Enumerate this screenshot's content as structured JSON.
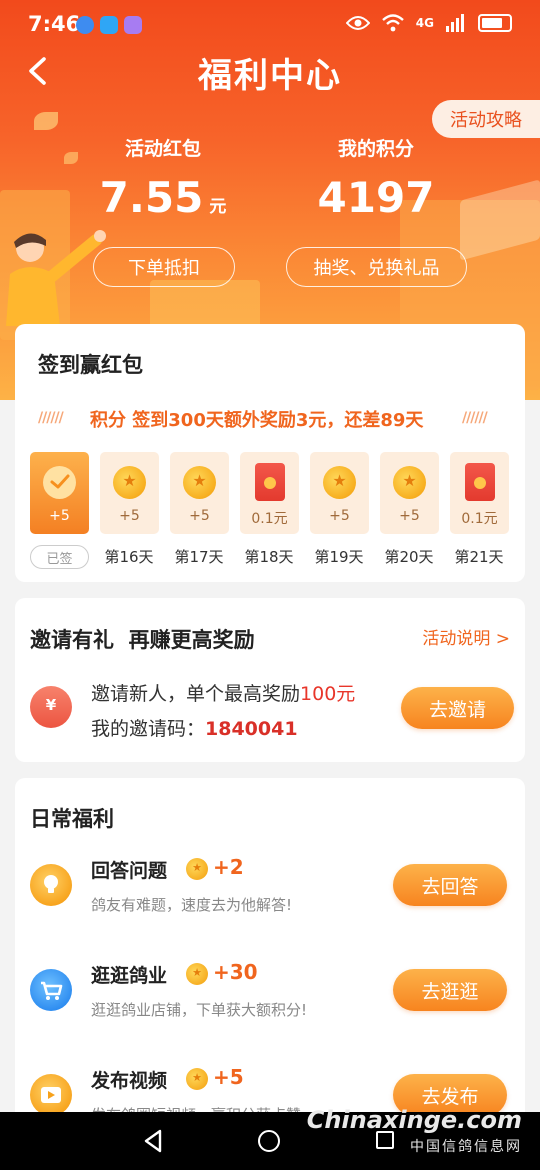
{
  "status_bar": {
    "time": "7:46",
    "network": "4G"
  },
  "header": {
    "title": "福利中心",
    "guide_link": "活动攻略",
    "red_packet": {
      "label": "活动红包",
      "value": "7.55",
      "unit": "元",
      "button": "下单抵扣"
    },
    "points": {
      "label": "我的积分",
      "value": "4197",
      "button": "抽奖、兑换礼品"
    }
  },
  "checkin": {
    "title": "签到赢红包",
    "marquee": "积分 签到300天额外奖励3元，还差89天",
    "signed_badge": "已签",
    "days": [
      {
        "reward": "+5",
        "label": "已签",
        "type": "signed"
      },
      {
        "reward": "+5",
        "label": "第16天",
        "type": "coin"
      },
      {
        "reward": "+5",
        "label": "第17天",
        "type": "coin"
      },
      {
        "reward": "0.1元",
        "label": "第18天",
        "type": "redpack"
      },
      {
        "reward": "+5",
        "label": "第19天",
        "type": "coin"
      },
      {
        "reward": "+5",
        "label": "第20天",
        "type": "coin"
      },
      {
        "reward": "0.1元",
        "label": "第21天",
        "type": "redpack"
      }
    ]
  },
  "invite": {
    "title": "邀请有礼  再赚更高奖励",
    "rules_link": "活动说明 >",
    "line1_prefix": "邀请新人，单个最高奖励",
    "line1_amount": "100元",
    "line2_prefix": "我的邀请码：",
    "code": "1840041",
    "button": "去邀请"
  },
  "daily": {
    "title": "日常福利",
    "tasks": [
      {
        "title": "回答问题",
        "points": "+2",
        "desc": "鸽友有难题，速度去为他解答!",
        "button": "去回答",
        "icon": "lightbulb-icon"
      },
      {
        "title": "逛逛鸽业",
        "points": "+30",
        "desc": "逛逛鸽业店铺，下单获大额积分!",
        "button": "去逛逛",
        "icon": "cart-icon"
      },
      {
        "title": "发布视频",
        "points": "+5",
        "desc": "发布鸽圈短视频，赢积分获点赞",
        "button": "去发布",
        "icon": "video-play-icon"
      }
    ]
  },
  "watermark": {
    "main": "Chinaxinge.com",
    "sub": "中国信鸽信息网"
  },
  "colors": {
    "accent": "#f0651e",
    "header_top": "#f24a1c",
    "header_bottom": "#fdb246",
    "amount_red": "#e8362a"
  }
}
